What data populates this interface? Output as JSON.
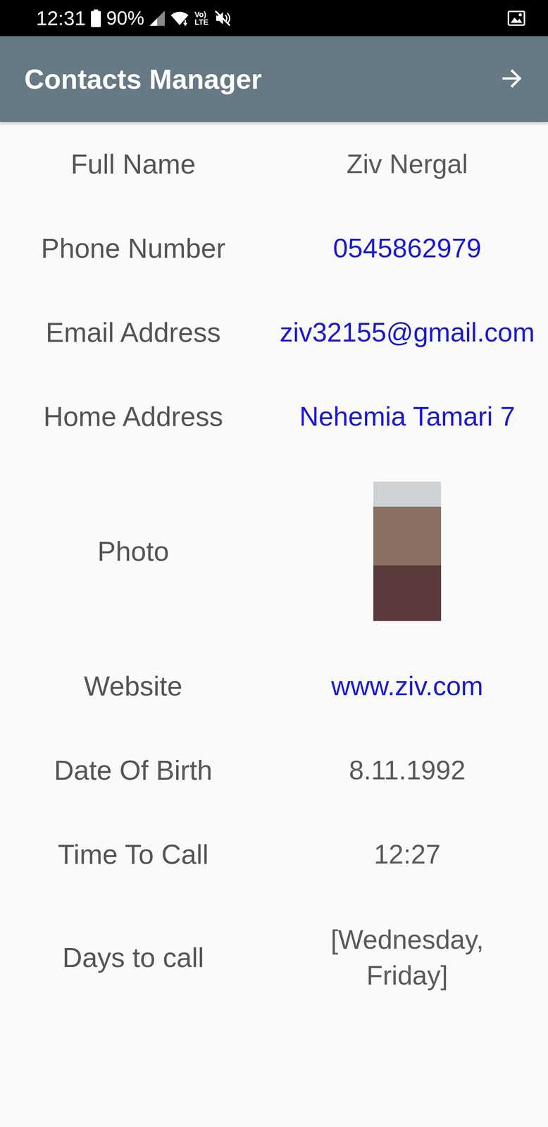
{
  "status_bar": {
    "time": "12:31",
    "battery": "90%",
    "network_top": "Vo)",
    "network_bottom": "LTE"
  },
  "app_bar": {
    "title": "Contacts Manager"
  },
  "fields": [
    {
      "label": "Full Name",
      "value": "Ziv Nergal",
      "kind": "text"
    },
    {
      "label": "Phone Number",
      "value": "0545862979",
      "kind": "link"
    },
    {
      "label": "Email Address",
      "value": "ziv32155@gmail.com",
      "kind": "link"
    },
    {
      "label": "Home Address",
      "value": "Nehemia Tamari 7",
      "kind": "link"
    },
    {
      "label": "Photo",
      "kind": "photo"
    },
    {
      "label": "Website",
      "value": "www.ziv.com",
      "kind": "link"
    },
    {
      "label": "Date Of Birth",
      "value": "8.11.1992",
      "kind": "text"
    },
    {
      "label": "Time To Call",
      "value": "12:27",
      "kind": "text"
    },
    {
      "label": "Days to call",
      "value": "[Wednesday, Friday]",
      "kind": "list"
    }
  ]
}
